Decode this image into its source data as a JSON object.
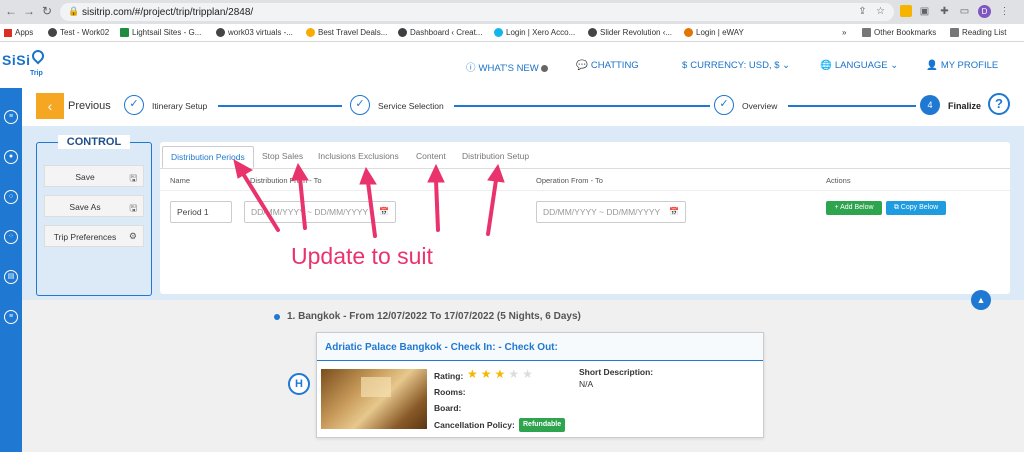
{
  "browser": {
    "url": "sisitrip.com/#/project/trip/tripplan/2848/",
    "bookmarks": [
      {
        "label": "Apps"
      },
      {
        "label": "Test - Work02"
      },
      {
        "label": "Lightsail Sites - G..."
      },
      {
        "label": "work03 virtuals -..."
      },
      {
        "label": "Best Travel Deals..."
      },
      {
        "label": "Dashboard ‹ Creat..."
      },
      {
        "label": "Login | Xero Acco..."
      },
      {
        "label": "Slider Revolution ‹..."
      },
      {
        "label": "Login | eWAY"
      },
      {
        "label": "»"
      },
      {
        "label": "Other Bookmarks"
      },
      {
        "label": "Reading List"
      }
    ],
    "profile_initial": "D"
  },
  "header": {
    "logo": "SiSi",
    "logo_sub": "Trip",
    "whats_new": "WHAT'S NEW",
    "chatting": "CHATTING",
    "currency": "CURRENCY: USD, $",
    "language": "LANGUAGE",
    "profile": "MY PROFILE"
  },
  "steps": {
    "previous": "Previous",
    "items": [
      {
        "label": "Itinerary Setup"
      },
      {
        "label": "Service Selection"
      },
      {
        "label": "Overview"
      }
    ],
    "current_number": "4",
    "current_label": "Finalize",
    "help": "?"
  },
  "control": {
    "title": "CONTROL",
    "buttons": [
      {
        "label": "Save",
        "icon": "floppy-disk-icon"
      },
      {
        "label": "Save As",
        "icon": "floppy-disk-icon"
      },
      {
        "label": "Trip Preferences",
        "icon": "gear-icon"
      }
    ]
  },
  "tabs": [
    {
      "label": "Distribution Periods",
      "active": true
    },
    {
      "label": "Stop Sales",
      "active": false
    },
    {
      "label": "Inclusions Exclusions",
      "active": false
    },
    {
      "label": "Content",
      "active": false
    },
    {
      "label": "Distribution Setup",
      "active": false
    }
  ],
  "table": {
    "headers": {
      "name": "Name",
      "distribution": "Distribution From - To",
      "operation": "Operation From - To",
      "actions": "Actions"
    },
    "row": {
      "name": "Period 1",
      "distribution_placeholder": "DD/MM/YYYY ~ DD/MM/YYYY",
      "operation_placeholder": "DD/MM/YYYY ~ DD/MM/YYYY",
      "add_below": "+ Add Below",
      "copy_below": "Copy Below"
    }
  },
  "annotation": "Update to suit",
  "itinerary": {
    "title": "1. Bangkok - From 12/07/2022 To 17/07/2022 (5 Nights, 6 Days)",
    "hotel": {
      "name": "Adriatic Palace Bangkok - Check In: - Check Out:",
      "badge": "H",
      "rating_label": "Rating:",
      "rating": 3,
      "rating_max": 5,
      "rooms_label": "Rooms:",
      "board_label": "Board:",
      "cancellation_label": "Cancellation Policy:",
      "cancellation_value": "Refundable",
      "short_desc_label": "Short Description:",
      "short_desc_value": "N/A"
    }
  },
  "colors": {
    "brand_blue": "#1f78d1",
    "previous_orange": "#f5a623",
    "annotation_pink": "#e8336d",
    "green": "#2ea44f"
  }
}
